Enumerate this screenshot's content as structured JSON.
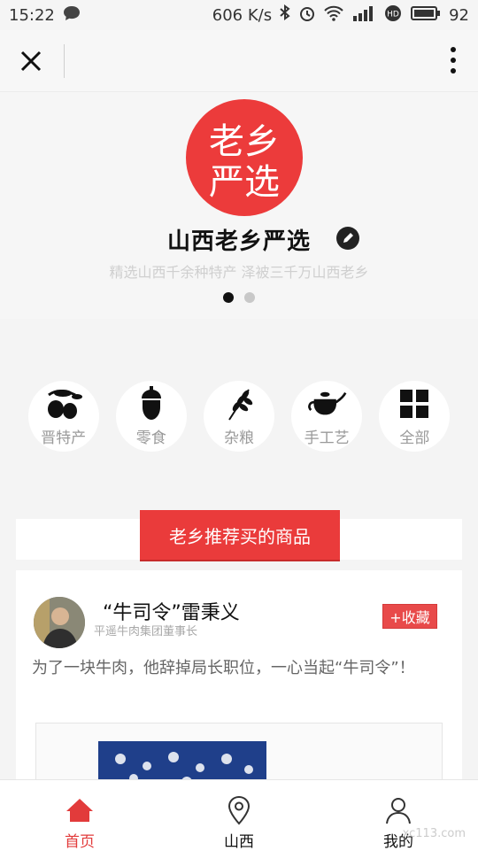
{
  "status": {
    "time": "15:22",
    "speed": "606 K/s",
    "battery": "92",
    "icons": [
      "chat-icon",
      "bluetooth-icon",
      "alarm-icon",
      "wifi-icon",
      "signal-icon",
      "hd-icon",
      "battery-icon"
    ]
  },
  "shop": {
    "logo_text_top": "老乡",
    "logo_text_bottom": "严选",
    "name": "山西老乡严选",
    "slogan": "精选山西千余种特产 泽被三千万山西老乡",
    "accent": "#ec3b3b"
  },
  "categories": [
    {
      "label": "晋特产",
      "icon": "olive-icon"
    },
    {
      "label": "零食",
      "icon": "acorn-icon"
    },
    {
      "label": "杂粮",
      "icon": "wheat-icon"
    },
    {
      "label": "手工艺",
      "icon": "teapot-icon"
    },
    {
      "label": "全部",
      "icon": "grid-icon"
    }
  ],
  "section": {
    "title": "老乡推荐买的商品"
  },
  "feature": {
    "name": "“牛司令”雷秉义",
    "title": "平遥牛肉集团董事长",
    "fav_button": "+收藏",
    "story": "为了一块牛肉，他辞掉局长职位，一心当起“牛司令”！"
  },
  "tabs": [
    {
      "label": "首页",
      "icon": "home-icon",
      "active": true
    },
    {
      "label": "山西",
      "icon": "location-pin-icon",
      "active": false
    },
    {
      "label": "我的",
      "icon": "user-icon",
      "active": false
    }
  ],
  "watermark": "xc113.com"
}
